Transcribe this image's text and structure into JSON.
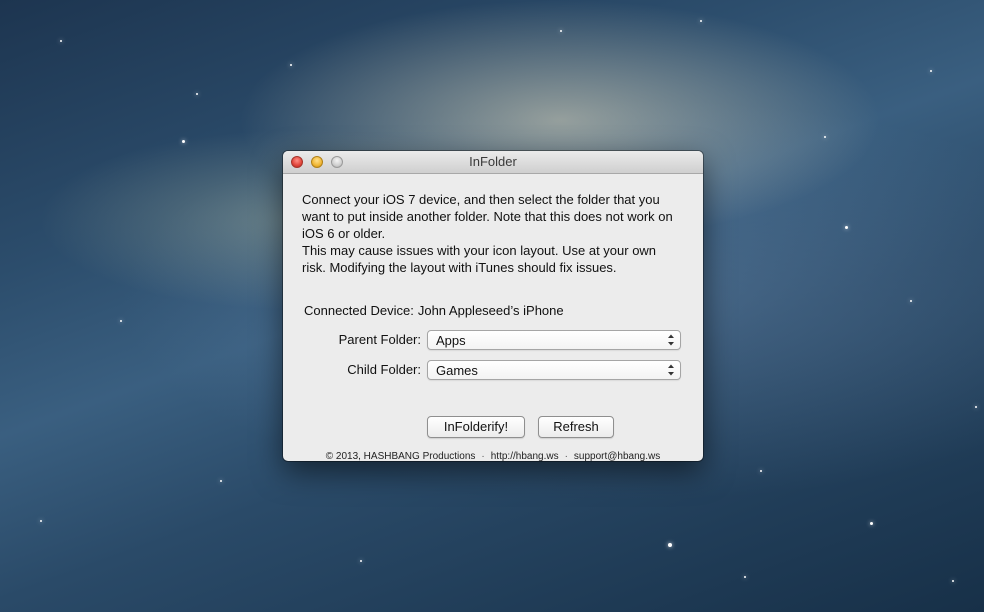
{
  "window": {
    "title": "InFolder"
  },
  "description": {
    "line1": "Connect your iOS 7 device, and then select the folder that you want to put inside another folder. Note that this does not work on iOS 6 or older.",
    "line2": "This may cause issues with your icon layout. Use at your own risk. Modifying the layout with iTunes should fix issues."
  },
  "device": {
    "label": "Connected Device:",
    "value": "John Appleseed’s iPhone"
  },
  "form": {
    "parent_label": "Parent Folder:",
    "parent_value": "Apps",
    "child_label": "Child Folder:",
    "child_value": "Games"
  },
  "buttons": {
    "infolderify": "InFolderify!",
    "refresh": "Refresh"
  },
  "footer": {
    "copyright": "© 2013, HASHBANG Productions",
    "website": "http://hbang.ws",
    "email": "support@hbang.ws",
    "separator": "·"
  },
  "icons": {
    "close": "close-icon",
    "minimize": "minimize-icon",
    "zoom": "zoom-icon",
    "popup_arrows": "chevron-up-down-icon"
  },
  "colors": {
    "window_bg": "#ececec",
    "close": "#e0443a",
    "minimize": "#f0b634",
    "zoom": "#cfcfcf"
  }
}
